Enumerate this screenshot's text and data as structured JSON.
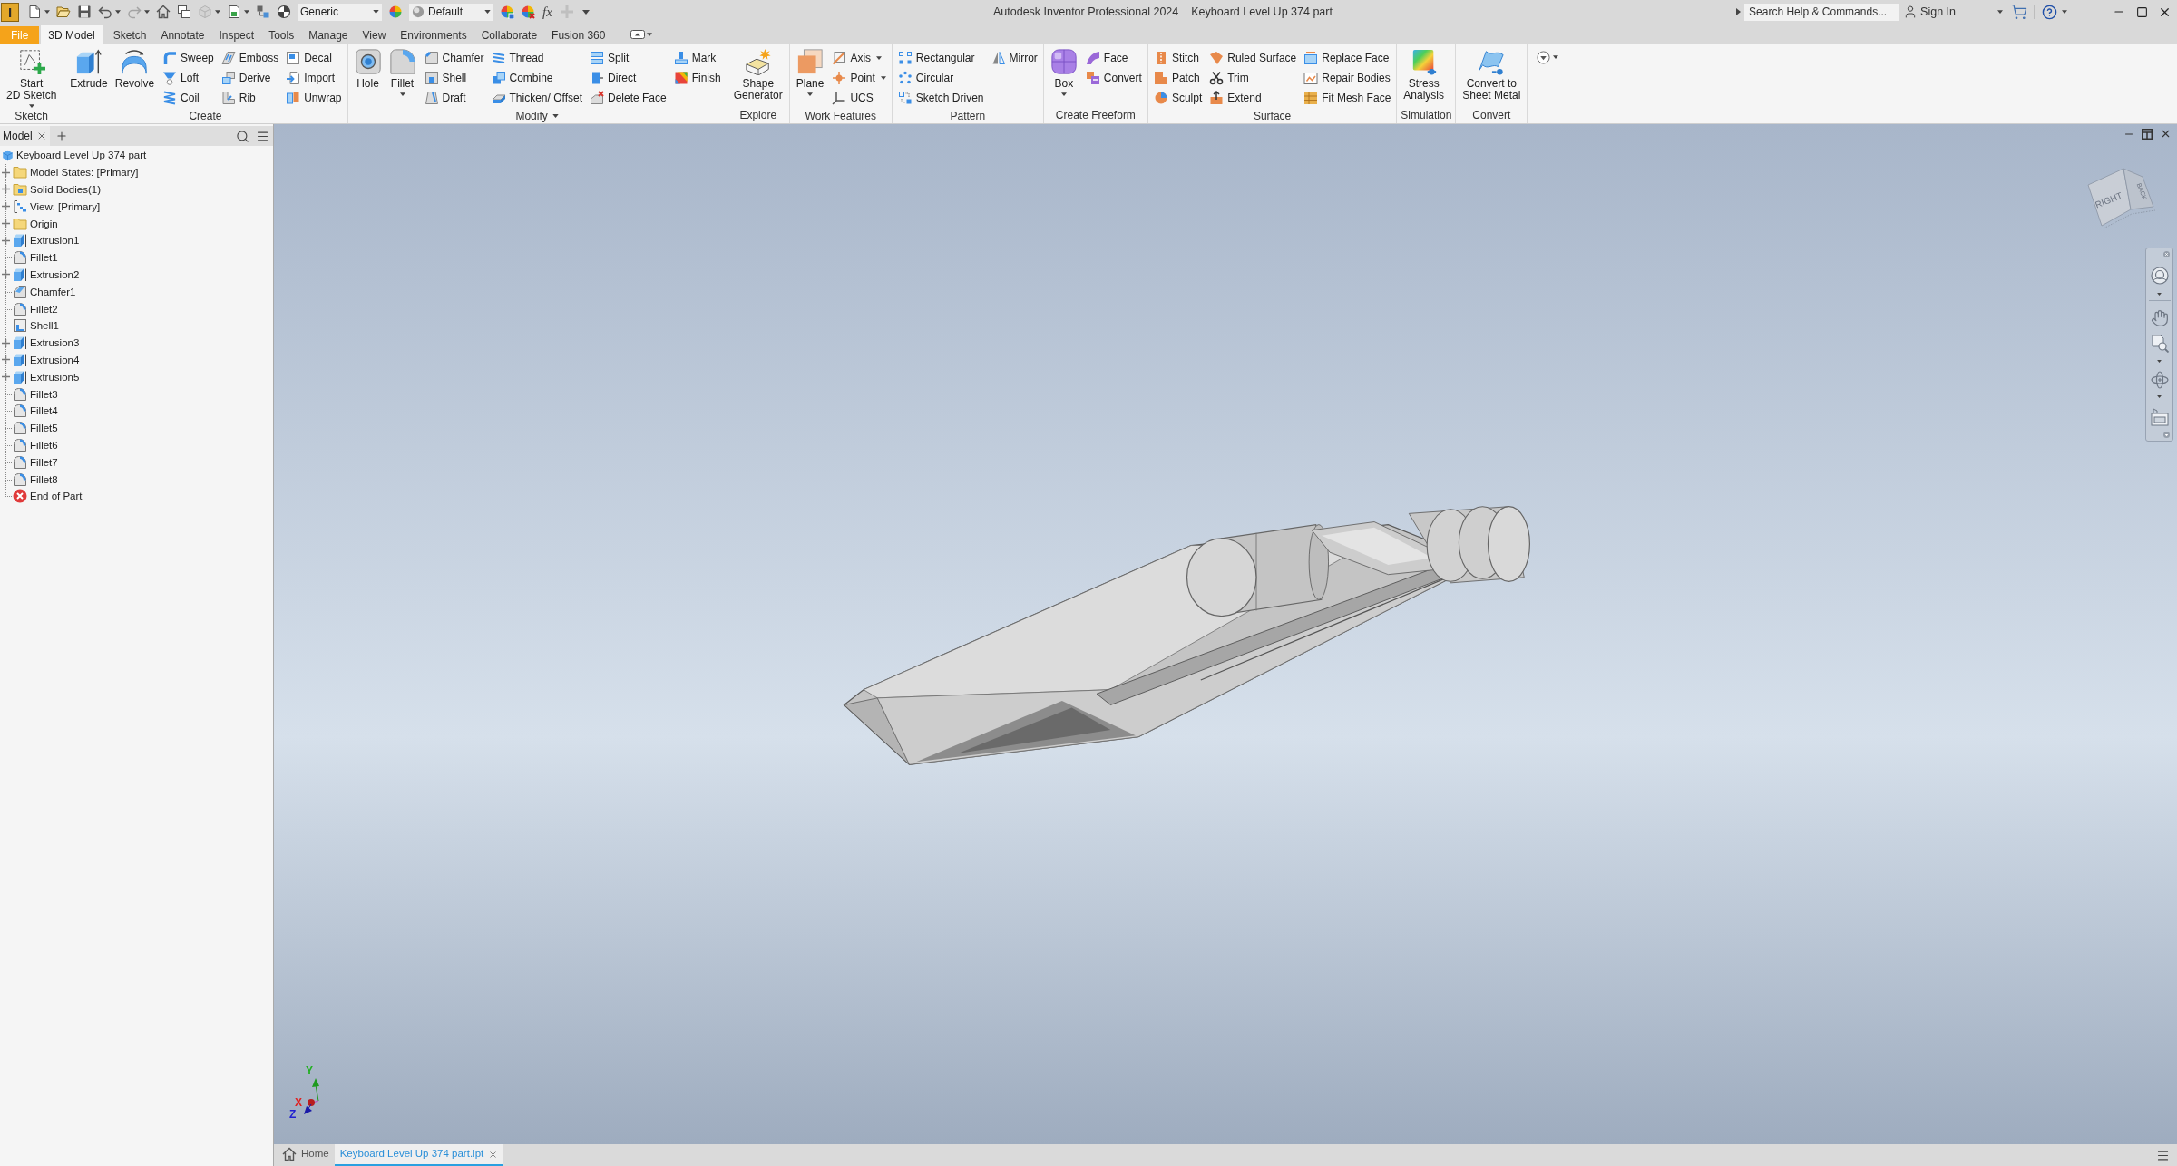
{
  "title_bar": {
    "logo": "I",
    "app_title": "Autodesk Inventor Professional 2024",
    "document_title": "Keyboard Level Up 374 part",
    "search": {
      "placeholder": "Search Help & Commands..."
    },
    "sign_in": "Sign In"
  },
  "quick_access": [
    {
      "kind": "icon",
      "dropdown": true,
      "disabled": false
    },
    {
      "kind": "icon",
      "dropdown": false,
      "disabled": false
    },
    {
      "kind": "icon",
      "dropdown": false,
      "disabled": false
    },
    {
      "kind": "icon",
      "dropdown": true,
      "disabled": false
    },
    {
      "kind": "icon",
      "dropdown": true,
      "disabled": true
    },
    {
      "kind": "icon",
      "dropdown": false,
      "disabled": false
    },
    {
      "kind": "icon",
      "dropdown": false,
      "disabled": false
    },
    {
      "kind": "icon",
      "dropdown": true,
      "disabled": true
    },
    {
      "kind": "icon",
      "dropdown": true,
      "disabled": false
    },
    {
      "kind": "icon",
      "dropdown": false,
      "disabled": false
    },
    {
      "kind": "icon",
      "dropdown": false,
      "disabled": false
    },
    {
      "kind": "select",
      "value": "Generic"
    },
    {
      "kind": "icon",
      "dropdown": false,
      "disabled": false
    },
    {
      "kind": "select",
      "value": "Default"
    },
    {
      "kind": "icon",
      "dropdown": false,
      "disabled": false
    },
    {
      "kind": "icon",
      "dropdown": false,
      "disabled": false
    },
    {
      "kind": "text",
      "text": "fx",
      "disabled": false
    },
    {
      "kind": "icon",
      "dropdown": false,
      "disabled": true
    },
    {
      "kind": "menu"
    }
  ],
  "ribbon_tabs": [
    {
      "label": "File",
      "kind": "file",
      "selected": false
    },
    {
      "label": "3D Model",
      "kind": "tab",
      "selected": true
    },
    {
      "label": "Sketch",
      "kind": "tab",
      "selected": false
    },
    {
      "label": "Annotate",
      "kind": "tab",
      "selected": false
    },
    {
      "label": "Inspect",
      "kind": "tab",
      "selected": false
    },
    {
      "label": "Tools",
      "kind": "tab",
      "selected": false
    },
    {
      "label": "Manage",
      "kind": "tab",
      "selected": false
    },
    {
      "label": "View",
      "kind": "tab",
      "selected": false
    },
    {
      "label": "Environments",
      "kind": "tab",
      "selected": false
    },
    {
      "label": "Collaborate",
      "kind": "tab",
      "selected": false
    },
    {
      "label": "Fusion 360",
      "kind": "tab",
      "selected": false
    }
  ],
  "ribbon_panels": [
    {
      "title": "Sketch",
      "menu": false,
      "groups": [
        {
          "kind": "large",
          "tools": [
            {
              "label": "Start\n2D Sketch",
              "dropdown": true
            }
          ]
        }
      ]
    },
    {
      "title": "Create",
      "menu": false,
      "groups": [
        {
          "kind": "large",
          "tools": [
            {
              "label": "Extrude",
              "dropdown": false
            },
            {
              "label": "Revolve",
              "dropdown": false
            }
          ]
        },
        {
          "kind": "small",
          "tools": [
            {
              "label": "Sweep",
              "dropdown": false
            },
            {
              "label": "Loft",
              "dropdown": false
            },
            {
              "label": "Coil",
              "dropdown": false
            }
          ]
        },
        {
          "kind": "small",
          "tools": [
            {
              "label": "Emboss",
              "dropdown": false
            },
            {
              "label": "Derive",
              "dropdown": false
            },
            {
              "label": "Rib",
              "dropdown": false
            }
          ]
        },
        {
          "kind": "small",
          "tools": [
            {
              "label": "Decal",
              "dropdown": false
            },
            {
              "label": "Import",
              "dropdown": false
            },
            {
              "label": "Unwrap",
              "dropdown": false
            }
          ]
        }
      ]
    },
    {
      "title": "Modify",
      "menu": true,
      "groups": [
        {
          "kind": "large",
          "tools": [
            {
              "label": "Hole",
              "dropdown": false
            },
            {
              "label": "Fillet",
              "dropdown": true
            }
          ]
        },
        {
          "kind": "small",
          "tools": [
            {
              "label": "Chamfer",
              "dropdown": false
            },
            {
              "label": "Shell",
              "dropdown": false
            },
            {
              "label": "Draft",
              "dropdown": false
            }
          ]
        },
        {
          "kind": "small",
          "tools": [
            {
              "label": "Thread",
              "dropdown": false
            },
            {
              "label": "Combine",
              "dropdown": false
            },
            {
              "label": "Thicken/ Offset",
              "dropdown": false
            }
          ]
        },
        {
          "kind": "small",
          "tools": [
            {
              "label": "Split",
              "dropdown": false
            },
            {
              "label": "Direct",
              "dropdown": false
            },
            {
              "label": "Delete Face",
              "dropdown": false
            }
          ]
        },
        {
          "kind": "small",
          "tools": [
            {
              "label": "Mark",
              "dropdown": false
            },
            {
              "label": "Finish",
              "dropdown": false
            }
          ]
        }
      ]
    },
    {
      "title": "Explore",
      "menu": false,
      "groups": [
        {
          "kind": "large",
          "tools": [
            {
              "label": "Shape\nGenerator",
              "dropdown": false
            }
          ]
        }
      ]
    },
    {
      "title": "Work Features",
      "menu": false,
      "groups": [
        {
          "kind": "large",
          "tools": [
            {
              "label": "Plane",
              "dropdown": true
            }
          ]
        },
        {
          "kind": "small",
          "tools": [
            {
              "label": "Axis",
              "dropdown": true
            },
            {
              "label": "Point",
              "dropdown": true
            },
            {
              "label": "UCS",
              "dropdown": false
            }
          ]
        }
      ]
    },
    {
      "title": "Pattern",
      "menu": false,
      "groups": [
        {
          "kind": "small",
          "tools": [
            {
              "label": "Rectangular",
              "dropdown": false
            },
            {
              "label": "Circular",
              "dropdown": false
            },
            {
              "label": "Sketch Driven",
              "dropdown": false
            }
          ]
        },
        {
          "kind": "small",
          "tools": [
            {
              "label": "Mirror",
              "dropdown": false
            }
          ]
        }
      ]
    },
    {
      "title": "Create Freeform",
      "menu": false,
      "groups": [
        {
          "kind": "large",
          "tools": [
            {
              "label": "Box",
              "dropdown": true
            }
          ]
        },
        {
          "kind": "small",
          "tools": [
            {
              "label": "Face",
              "dropdown": false
            },
            {
              "label": "Convert",
              "dropdown": false
            }
          ]
        }
      ]
    },
    {
      "title": "Surface",
      "menu": false,
      "groups": [
        {
          "kind": "small",
          "tools": [
            {
              "label": "Stitch",
              "dropdown": false
            },
            {
              "label": "Patch",
              "dropdown": false
            },
            {
              "label": "Sculpt",
              "dropdown": false
            }
          ]
        },
        {
          "kind": "small",
          "tools": [
            {
              "label": "Ruled Surface",
              "dropdown": false
            },
            {
              "label": "Trim",
              "dropdown": false
            },
            {
              "label": "Extend",
              "dropdown": false
            }
          ]
        },
        {
          "kind": "small",
          "tools": [
            {
              "label": "Replace Face",
              "dropdown": false
            },
            {
              "label": "Repair Bodies",
              "dropdown": false
            },
            {
              "label": "Fit Mesh Face",
              "dropdown": false
            }
          ]
        }
      ]
    },
    {
      "title": "Simulation",
      "menu": false,
      "groups": [
        {
          "kind": "large",
          "tools": [
            {
              "label": "Stress\nAnalysis",
              "dropdown": false
            }
          ]
        }
      ]
    },
    {
      "title": "Convert",
      "menu": false,
      "groups": [
        {
          "kind": "large",
          "tools": [
            {
              "label": "Convert to\nSheet Metal",
              "dropdown": false
            }
          ]
        }
      ]
    }
  ],
  "browser": {
    "tabs": [
      {
        "label": "Model",
        "selected": true
      }
    ],
    "tree": [
      {
        "label": "Keyboard Level Up 374 part",
        "kind": "part",
        "children": [
          {
            "label": "Model States: [Primary]",
            "kind": "folder",
            "expandable": true
          },
          {
            "label": "Solid Bodies(1)",
            "kind": "bodies",
            "expandable": true
          },
          {
            "label": "View: [Primary]",
            "kind": "view",
            "expandable": true
          },
          {
            "label": "Origin",
            "kind": "folder",
            "expandable": true
          },
          {
            "label": "Extrusion1",
            "kind": "extrusion",
            "expandable": true
          },
          {
            "label": "Fillet1",
            "kind": "fillet",
            "expandable": false
          },
          {
            "label": "Extrusion2",
            "kind": "extrusion",
            "expandable": true
          },
          {
            "label": "Chamfer1",
            "kind": "chamfer",
            "expandable": false
          },
          {
            "label": "Fillet2",
            "kind": "fillet",
            "expandable": false
          },
          {
            "label": "Shell1",
            "kind": "shell",
            "expandable": false
          },
          {
            "label": "Extrusion3",
            "kind": "extrusion",
            "expandable": true
          },
          {
            "label": "Extrusion4",
            "kind": "extrusion",
            "expandable": true
          },
          {
            "label": "Extrusion5",
            "kind": "extrusion",
            "expandable": true
          },
          {
            "label": "Fillet3",
            "kind": "fillet",
            "expandable": false
          },
          {
            "label": "Fillet4",
            "kind": "fillet",
            "expandable": false
          },
          {
            "label": "Fillet5",
            "kind": "fillet",
            "expandable": false
          },
          {
            "label": "Fillet6",
            "kind": "fillet",
            "expandable": false
          },
          {
            "label": "Fillet7",
            "kind": "fillet",
            "expandable": false
          },
          {
            "label": "Fillet8",
            "kind": "fillet",
            "expandable": false
          },
          {
            "label": "End of Part",
            "kind": "end",
            "expandable": false
          }
        ]
      }
    ]
  },
  "viewport": {
    "view_cube": {
      "faces": [
        "RIGHT",
        "BACK"
      ]
    },
    "axis_labels": [
      {
        "text": "Y",
        "color": "#22b022"
      },
      {
        "text": "X",
        "color": "#e02020"
      },
      {
        "text": "Z",
        "color": "#2020d0"
      }
    ]
  },
  "document_tabs": [
    {
      "label": "Home",
      "kind": "home",
      "selected": false
    },
    {
      "label": "Keyboard Level Up 374 part.ipt",
      "kind": "document",
      "selected": true
    }
  ]
}
